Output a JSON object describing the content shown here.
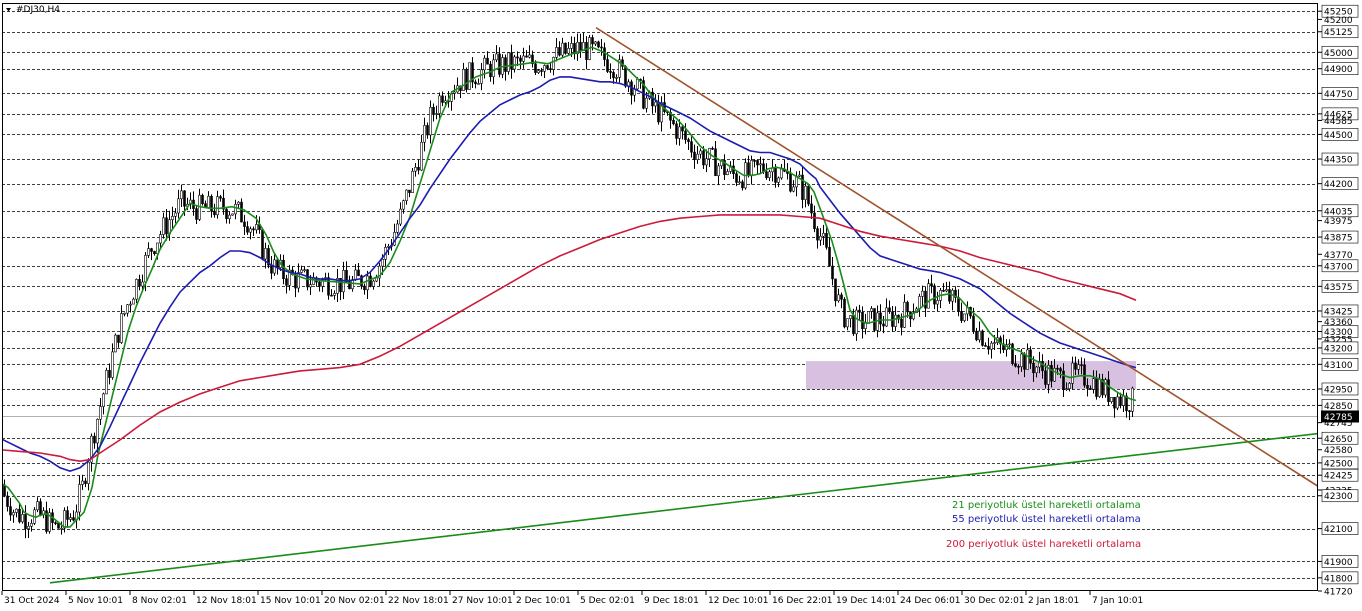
{
  "chart_data": {
    "type": "candlestick",
    "title": "#DJ30,H4",
    "ylim": [
      41720,
      45300
    ],
    "current_price": 42785,
    "price_ticks": [
      45250,
      45200,
      45125,
      45000,
      44900,
      44750,
      44625,
      44585,
      44500,
      44350,
      44200,
      44035,
      43975,
      43875,
      43770,
      43700,
      43575,
      43425,
      43360,
      43300,
      43255,
      43200,
      43100,
      42950,
      42850,
      42745,
      42650,
      42580,
      42500,
      42425,
      42335,
      42300,
      42100,
      41900,
      41800,
      41720
    ],
    "price_labels": [
      "45250",
      "45200",
      "45125",
      "45000",
      "44900",
      "44750",
      "44625",
      "44585",
      "44500",
      "44350",
      "44200",
      "44035",
      "43975",
      "43875",
      "43770",
      "43700",
      "43575",
      "43425",
      "43360",
      "43300",
      "43255",
      "43200",
      "43100",
      "42950",
      "42850",
      "42745",
      "42650",
      "42580",
      "42500",
      "42425",
      "42335",
      "42300",
      "42100",
      "41900",
      "41800",
      "41720"
    ],
    "highlighted_labels": [
      "45250",
      "45125",
      "45000",
      "44900",
      "44750",
      "44625",
      "44500",
      "44350",
      "44200",
      "44035",
      "43875",
      "43700",
      "43575",
      "43425",
      "43300",
      "43200",
      "43100",
      "42950",
      "42850",
      "42650",
      "42500",
      "42425",
      "42300",
      "42100",
      "41900",
      "41800"
    ],
    "time_labels": [
      "31 Oct 2024",
      "5 Nov 10:01",
      "8 Nov 02:01",
      "12 Nov 18:01",
      "15 Nov 10:01",
      "20 Nov 02:01",
      "22 Nov 18:01",
      "27 Nov 10:01",
      "2 Dec 10:01",
      "5 Dec 02:01",
      "9 Dec 18:01",
      "12 Dec 10:01",
      "16 Dec 22:01",
      "19 Dec 14:01",
      "24 Dec 06:01",
      "30 Dec 02:01",
      "2 Jan 18:01",
      "7 Jan 10:01"
    ],
    "series": [
      {
        "name": "21 periyotluk üstel hareketli ortalama",
        "color": "#1a8c1a",
        "x": [
          0,
          8,
          14,
          20,
          24,
          30,
          36,
          40,
          46,
          52,
          58,
          64,
          70,
          76,
          84,
          92,
          98,
          104,
          112,
          120,
          128,
          136,
          144,
          152,
          160,
          170,
          180,
          190,
          200,
          210,
          220,
          232,
          244,
          256,
          266,
          274,
          282,
          292,
          306,
          320,
          340,
          360,
          380,
          390,
          400,
          410,
          420,
          430,
          440,
          452,
          464,
          476,
          490,
          500,
          512,
          524,
          536,
          548,
          560,
          572,
          582,
          592,
          604,
          614,
          624,
          634,
          644,
          654,
          664,
          676,
          688,
          700,
          712,
          724,
          736,
          744,
          752,
          760,
          768,
          776,
          784,
          792,
          800,
          808,
          814,
          820,
          826,
          832,
          838,
          844,
          850,
          856,
          862,
          868,
          874,
          880,
          886,
          892,
          898,
          904,
          910,
          916,
          922,
          930,
          940,
          950,
          960,
          970,
          980,
          990,
          1000,
          1010,
          1020,
          1030,
          1040,
          1050,
          1060,
          1070,
          1080,
          1090,
          1100,
          1110,
          1120,
          1130,
          1136
        ],
        "y": [
          42380,
          42350,
          42300,
          42250,
          42200,
          42180,
          42170,
          42180,
          42190,
          42170,
          42140,
          42110,
          42110,
          42150,
          42200,
          42350,
          42550,
          42700,
          42900,
          43100,
          43300,
          43450,
          43570,
          43680,
          43800,
          43900,
          43990,
          44080,
          44060,
          44050,
          44050,
          44060,
          44040,
          43990,
          43890,
          43780,
          43700,
          43650,
          43620,
          43610,
          43600,
          43590,
          43640,
          43720,
          43850,
          44000,
          44200,
          44400,
          44600,
          44760,
          44800,
          44850,
          44880,
          44910,
          44920,
          44930,
          44940,
          44930,
          44960,
          44990,
          45010,
          45030,
          45000,
          44960,
          44920,
          44860,
          44800,
          44720,
          44660,
          44600,
          44520,
          44430,
          44370,
          44330,
          44280,
          44250,
          44250,
          44260,
          44290,
          44300,
          44290,
          44260,
          44230,
          44200,
          44150,
          44050,
          43950,
          43850,
          43720,
          43580,
          43430,
          43380,
          43360,
          43350,
          43360,
          43370,
          43370,
          43370,
          43380,
          43390,
          43400,
          43420,
          43450,
          43490,
          43520,
          43530,
          43500,
          43430,
          43380,
          43290,
          43230,
          43200,
          43180,
          43140,
          43110,
          43070,
          43040,
          43020,
          43030,
          43030,
          43010,
          42960,
          42920,
          42890,
          42880
        ]
      },
      {
        "name": "55 periyotluk üstel hareketli ortalama",
        "color": "#1c1cb0",
        "x": [
          0,
          10,
          20,
          30,
          40,
          50,
          60,
          70,
          80,
          90,
          100,
          110,
          120,
          130,
          140,
          150,
          160,
          170,
          180,
          190,
          200,
          210,
          220,
          230,
          240,
          250,
          260,
          270,
          280,
          290,
          300,
          310,
          320,
          330,
          340,
          350,
          360,
          370,
          380,
          390,
          400,
          410,
          420,
          430,
          440,
          450,
          460,
          470,
          480,
          490,
          500,
          510,
          520,
          530,
          540,
          550,
          560,
          570,
          580,
          590,
          600,
          610,
          620,
          630,
          640,
          650,
          660,
          670,
          680,
          690,
          700,
          710,
          720,
          730,
          740,
          750,
          760,
          770,
          780,
          790,
          800,
          810,
          816,
          820,
          830,
          840,
          850,
          860,
          870,
          880,
          890,
          900,
          910,
          920,
          930,
          940,
          950,
          960,
          970,
          980,
          990,
          1000,
          1010,
          1020,
          1030,
          1040,
          1050,
          1060,
          1070,
          1080,
          1090,
          1100,
          1110,
          1120,
          1130,
          1136
        ],
        "y": [
          42650,
          42620,
          42590,
          42560,
          42540,
          42510,
          42470,
          42450,
          42470,
          42520,
          42600,
          42720,
          42850,
          42980,
          43110,
          43230,
          43350,
          43450,
          43540,
          43600,
          43660,
          43700,
          43750,
          43790,
          43790,
          43780,
          43750,
          43710,
          43680,
          43660,
          43650,
          43630,
          43620,
          43620,
          43610,
          43610,
          43620,
          43660,
          43730,
          43810,
          43900,
          43990,
          44070,
          44170,
          44260,
          44350,
          44430,
          44510,
          44580,
          44630,
          44680,
          44710,
          44740,
          44760,
          44790,
          44830,
          44850,
          44850,
          44840,
          44830,
          44820,
          44820,
          44810,
          44790,
          44760,
          44730,
          44690,
          44660,
          44630,
          44600,
          44560,
          44520,
          44490,
          44460,
          44430,
          44400,
          44390,
          44390,
          44370,
          44350,
          44320,
          44260,
          44230,
          44180,
          44100,
          44020,
          43950,
          43880,
          43810,
          43760,
          43740,
          43720,
          43700,
          43680,
          43670,
          43660,
          43640,
          43620,
          43590,
          43560,
          43510,
          43460,
          43410,
          43370,
          43330,
          43290,
          43260,
          43230,
          43210,
          43190,
          43170,
          43150,
          43130,
          43110,
          43090,
          43080
        ]
      },
      {
        "name": "200 periyotluk üstel hareketli ortalama",
        "color": "#cc1a3a",
        "x": [
          0,
          20,
          40,
          60,
          70,
          80,
          90,
          100,
          120,
          140,
          160,
          180,
          200,
          220,
          240,
          260,
          280,
          300,
          320,
          340,
          360,
          380,
          400,
          420,
          440,
          460,
          480,
          500,
          520,
          540,
          560,
          580,
          600,
          620,
          640,
          660,
          680,
          700,
          720,
          740,
          760,
          780,
          800,
          820,
          840,
          860,
          880,
          900,
          920,
          940,
          960,
          980,
          1000,
          1020,
          1040,
          1060,
          1080,
          1100,
          1120,
          1136
        ],
        "y": [
          42580,
          42570,
          42560,
          42540,
          42520,
          42510,
          42520,
          42560,
          42640,
          42730,
          42810,
          42870,
          42920,
          42960,
          43000,
          43020,
          43040,
          43060,
          43070,
          43080,
          43100,
          43150,
          43210,
          43280,
          43350,
          43420,
          43490,
          43560,
          43630,
          43700,
          43760,
          43810,
          43860,
          43900,
          43940,
          43970,
          43990,
          44000,
          44010,
          44010,
          44010,
          44010,
          44000,
          43990,
          43950,
          43910,
          43880,
          43860,
          43840,
          43820,
          43790,
          43750,
          43720,
          43690,
          43660,
          43620,
          43590,
          43560,
          43530,
          43490
        ]
      }
    ],
    "trendlines": [
      {
        "x1": 596,
        "y1": 45150,
        "x2": 1320,
        "y2": 42350,
        "color": "#a0522d"
      },
      {
        "x1": 50,
        "y1": 41770,
        "x2": 1320,
        "y2": 42680,
        "color": "#1a8c1a"
      }
    ],
    "zone": {
      "x1": 806,
      "x2": 1136,
      "y_low": 42950,
      "y_high": 43120,
      "color": "#d8c0e0"
    },
    "legend": [
      "21 periyotluk üstel hareketli ortalama",
      "55 periyotluk üstel hareketli ortalama",
      "200 periyotluk üstel hareketli ortalama"
    ],
    "legend_colors": [
      "#1a8c1a",
      "#1c1cb0",
      "#cc1a3a"
    ]
  }
}
